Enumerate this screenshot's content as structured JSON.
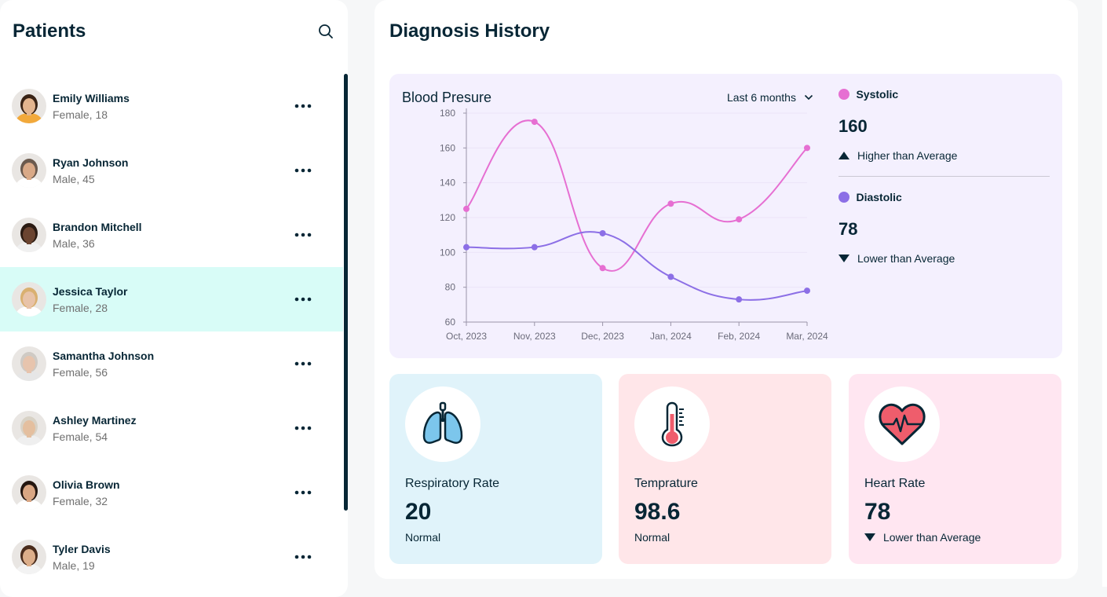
{
  "patients_panel": {
    "title": "Patients",
    "list": [
      {
        "name": "Emily Williams",
        "meta": "Female, 18",
        "active": false,
        "skin": "#e3b58f",
        "hair": "#3a2416",
        "shirt": "#f2a93b"
      },
      {
        "name": "Ryan Johnson",
        "meta": "Male, 45",
        "active": false,
        "skin": "#d9a987",
        "hair": "#6b5a4e",
        "shirt": "#ffffff"
      },
      {
        "name": "Brandon Mitchell",
        "meta": "Male, 36",
        "active": false,
        "skin": "#6b4430",
        "hair": "#2b1b12",
        "shirt": "#f0f0f0"
      },
      {
        "name": "Jessica Taylor",
        "meta": "Female, 28",
        "active": true,
        "skin": "#e8c3a8",
        "hair": "#d9b070",
        "shirt": "#ffffff"
      },
      {
        "name": "Samantha Johnson",
        "meta": "Female, 56",
        "active": false,
        "skin": "#e7c4ad",
        "hair": "#cfcac4",
        "shirt": "#e6e6e6"
      },
      {
        "name": "Ashley Martinez",
        "meta": "Female, 54",
        "active": false,
        "skin": "#e4bf9f",
        "hair": "#d8d2c6",
        "shirt": "#efefef"
      },
      {
        "name": "Olivia Brown",
        "meta": "Female, 32",
        "active": false,
        "skin": "#d9a683",
        "hair": "#241610",
        "shirt": "#ffffff"
      },
      {
        "name": "Tyler Davis",
        "meta": "Male, 19",
        "active": false,
        "skin": "#dcae8a",
        "hair": "#4a2c1c",
        "shirt": "#f3f3f3"
      }
    ]
  },
  "diagnosis": {
    "title": "Diagnosis History",
    "blood_pressure": {
      "title": "Blood Presure",
      "range": "Last 6 months",
      "systolic": {
        "label": "Systolic",
        "value": "160",
        "trend": "Higher than Average",
        "color": "#e66fd2"
      },
      "diastolic": {
        "label": "Diastolic",
        "value": "78",
        "trend": "Lower than Average",
        "color": "#8c6fe6"
      }
    },
    "vitals": [
      {
        "label": "Respiratory Rate",
        "value": "20",
        "status": "Normal",
        "bg": "#e0f3fa",
        "icon": "lungs-icon"
      },
      {
        "label": "Temprature",
        "value": "98.6",
        "status": "Normal",
        "bg": "#ffe6e9",
        "icon": "thermometer-icon"
      },
      {
        "label": "Heart Rate",
        "value": "78",
        "status": "Lower than Average",
        "bg": "#ffe6f1",
        "icon": "heart-icon"
      }
    ]
  },
  "chart_data": {
    "type": "line",
    "title": "Blood Presure",
    "categories": [
      "Oct, 2023",
      "Nov, 2023",
      "Dec, 2023",
      "Jan, 2024",
      "Feb, 2024",
      "Mar, 2024"
    ],
    "series": [
      {
        "name": "Systolic",
        "values": [
          125,
          175,
          91,
          128,
          119,
          160
        ],
        "color": "#e66fd2"
      },
      {
        "name": "Diastolic",
        "values": [
          103,
          103,
          111,
          86,
          73,
          78
        ],
        "color": "#8c6fe6"
      }
    ],
    "yticks": [
      "60",
      "80",
      "100",
      "120",
      "140",
      "160",
      "180"
    ],
    "ylim": [
      60,
      180
    ],
    "grid": true
  }
}
